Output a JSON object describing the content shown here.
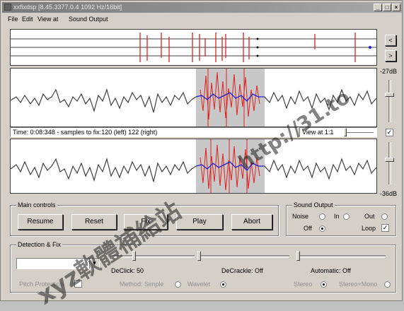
{
  "window": {
    "title": "xxfixdsp [8.45.3377.0.4 1092 Hz/16bit]"
  },
  "menu": [
    "File",
    "Edit",
    "View at",
    "Sound Output"
  ],
  "scale": {
    "top": "-27dB",
    "bottom": "-36dB"
  },
  "info": {
    "status": "Time: 0:08:348 - samples to fix:120 (left) 122 (right)",
    "view_at": "View at 1:1"
  },
  "main_controls": {
    "title": "Main controls",
    "buttons": [
      "Resume",
      "Reset",
      "Fix",
      "Play",
      "Abort"
    ]
  },
  "sound_output": {
    "title": "Sound Output",
    "noise": "Noise",
    "in": "In",
    "out": "Out",
    "off": "Off",
    "loop": "Loop",
    "loop_checked": true
  },
  "detection": {
    "title": "Detection & Fix",
    "declick": "DeClick: 50",
    "decrackle": "DeCrackle: Off",
    "automatic": "Automatic: Off",
    "pitch_protection": "Pitch Protection",
    "method": "Method: Simple",
    "wavelet": "Wavelet",
    "stereo": "Stereo",
    "stereo_mono": "Stereo+Mono"
  },
  "watermark": {
    "line1": "xyz軟體補給站",
    "line2": "http://31.to"
  },
  "colors": {
    "wave": "#404040",
    "click": "#e02020",
    "fixed": "#2020d0",
    "selection": "#c8c8c8"
  }
}
